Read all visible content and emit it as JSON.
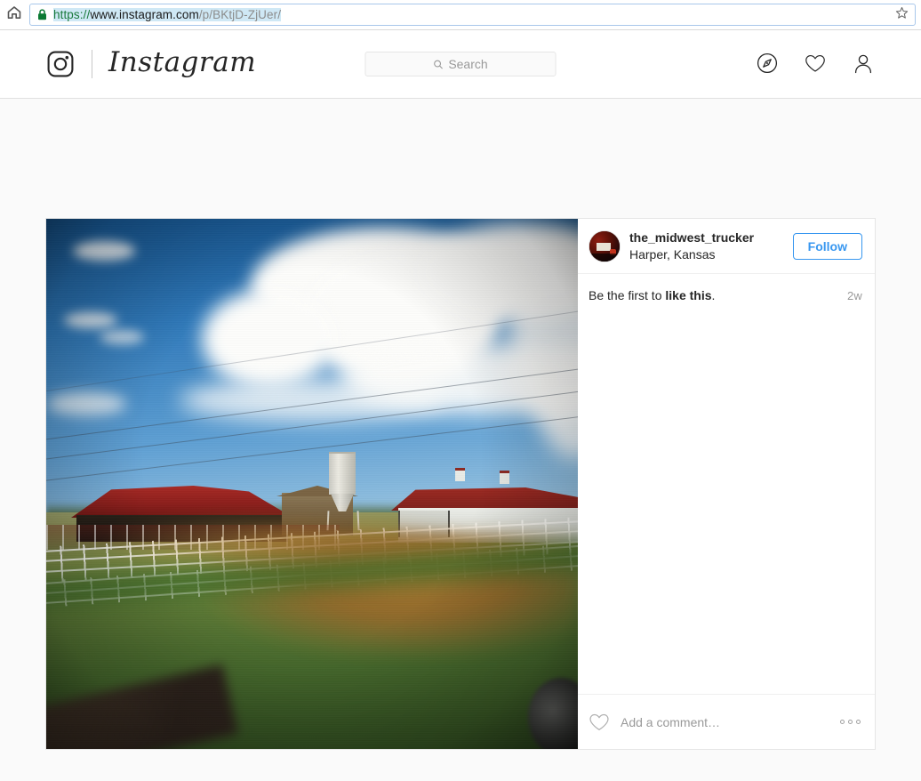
{
  "browser": {
    "home_icon": "home-icon",
    "lock_icon": "lock-icon",
    "star_icon": "star-icon",
    "url": {
      "scheme": "https://",
      "host": "www.instagram.com",
      "path": "/p/BKtjD-ZjUer/",
      "full": "https://www.instagram.com/p/BKtjD-ZjUer/"
    }
  },
  "nav": {
    "brand_name": "Instagram",
    "camera_icon": "instagram-camera-icon",
    "search": {
      "placeholder": "Search",
      "icon": "search-icon"
    },
    "icons": [
      {
        "name": "explore-compass-icon"
      },
      {
        "name": "activity-heart-icon"
      },
      {
        "name": "profile-person-icon"
      }
    ]
  },
  "post": {
    "photo_alt": "farm-photo-red-roof-barn",
    "author": {
      "username": "the_midwest_trucker",
      "location": "Harper, Kansas",
      "avatar": "user-avatar"
    },
    "follow_label": "Follow",
    "likes_prefix": "Be the first to ",
    "likes_link": "like this",
    "likes_suffix": ".",
    "timestamp": "2w",
    "comment_placeholder": "Add a comment…",
    "comment_value": "",
    "heart_icon": "like-heart-icon",
    "more_icon": "more-options-icon"
  },
  "colors": {
    "brand_blue": "#3897f0",
    "text_primary": "#262626",
    "text_muted": "#999999",
    "page_bg": "#fafafa",
    "border": "#e6e6e6",
    "url_scheme_green": "#1a7a3c",
    "url_selection": "#cfe8f5"
  }
}
